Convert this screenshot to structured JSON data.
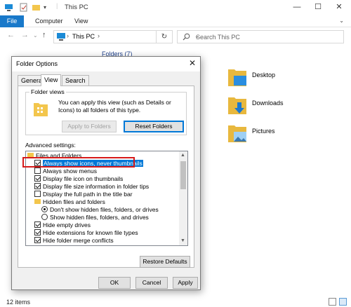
{
  "explorer": {
    "title": "This PC",
    "ribbon_tabs": [
      "File",
      "Computer",
      "View"
    ],
    "address": {
      "location": "This PC"
    },
    "search": {
      "placeholder": "Search This PC"
    },
    "folders_heading": "Folders (7)",
    "folders": [
      {
        "label": "Desktop",
        "icon": "desktop-folder-icon"
      },
      {
        "label": "Downloads",
        "icon": "downloads-folder-icon"
      },
      {
        "label": "Pictures",
        "icon": "pictures-folder-icon"
      }
    ],
    "status": {
      "items": "12 items"
    }
  },
  "dialog": {
    "title": "Folder Options",
    "tabs": [
      "General",
      "View",
      "Search"
    ],
    "active_tab": "View",
    "folder_views": {
      "legend": "Folder views",
      "description": "You can apply this view (such as Details or Icons) to all folders of this type.",
      "apply_button": "Apply to Folders",
      "reset_button": "Reset Folders"
    },
    "advanced_label": "Advanced settings:",
    "settings": [
      {
        "kind": "folder",
        "label": "Files and Folders"
      },
      {
        "kind": "checkbox",
        "checked": true,
        "selected": true,
        "label": "Always show icons, never thumbnails"
      },
      {
        "kind": "checkbox",
        "checked": false,
        "label": "Always show menus"
      },
      {
        "kind": "checkbox",
        "checked": true,
        "label": "Display file icon on thumbnails"
      },
      {
        "kind": "checkbox",
        "checked": true,
        "label": "Display file size information in folder tips"
      },
      {
        "kind": "checkbox",
        "checked": false,
        "label": "Display the full path in the title bar"
      },
      {
        "kind": "folder",
        "label": "Hidden files and folders"
      },
      {
        "kind": "radio",
        "checked": true,
        "label": "Don't show hidden files, folders, or drives"
      },
      {
        "kind": "radio",
        "checked": false,
        "label": "Show hidden files, folders, and drives"
      },
      {
        "kind": "checkbox",
        "checked": true,
        "label": "Hide empty drives"
      },
      {
        "kind": "checkbox",
        "checked": true,
        "label": "Hide extensions for known file types"
      },
      {
        "kind": "checkbox",
        "checked": true,
        "label": "Hide folder merge conflicts"
      }
    ],
    "restore_button": "Restore Defaults",
    "ok_button": "OK",
    "cancel_button": "Cancel",
    "apply_button": "Apply"
  },
  "colors": {
    "accent": "#0078d7",
    "file_tab": "#1979ca",
    "highlight_box": "#d61a1a",
    "folder": "#f3c64d"
  }
}
